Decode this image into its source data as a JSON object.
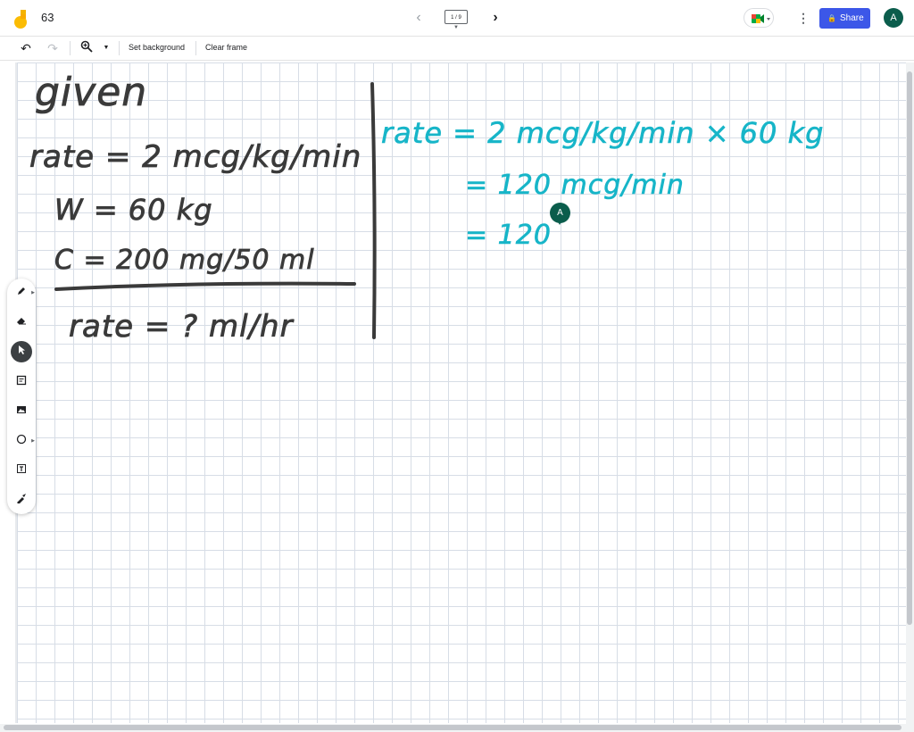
{
  "header": {
    "title": "63",
    "frame_counter": "1 / 9",
    "share_label": "Share",
    "avatar_initial": "A"
  },
  "toolbar": {
    "set_background_label": "Set background",
    "clear_frame_label": "Clear frame"
  },
  "sidebar": {
    "tools": [
      {
        "name": "pen",
        "icon": "pen-icon"
      },
      {
        "name": "eraser",
        "icon": "eraser-icon"
      },
      {
        "name": "select",
        "icon": "cursor-icon",
        "active": true
      },
      {
        "name": "sticky-note",
        "icon": "sticky-note-icon"
      },
      {
        "name": "image",
        "icon": "image-icon"
      },
      {
        "name": "shape",
        "icon": "circle-icon"
      },
      {
        "name": "text-box",
        "icon": "text-box-icon"
      },
      {
        "name": "laser",
        "icon": "laser-icon"
      }
    ]
  },
  "canvas": {
    "left_notes": {
      "heading": "given",
      "line1": "rate = 2 mcg/kg/min",
      "line2": "W = 60 kg",
      "line3": "C = 200 mg/50 ml",
      "line4": "rate = ?  ml/hr"
    },
    "right_notes": {
      "line1": "rate = 2 mcg/kg/min × 60 kg",
      "line2": "= 120  mcg/min",
      "line3": "= 120"
    },
    "collaborator_cursor": "A"
  },
  "colors": {
    "share_button": "#3c57e8",
    "avatar": "#0b5d4c",
    "ink_black": "#3a3a3a",
    "ink_cyan": "#17b5c8",
    "grid_line": "#d7dde6"
  }
}
